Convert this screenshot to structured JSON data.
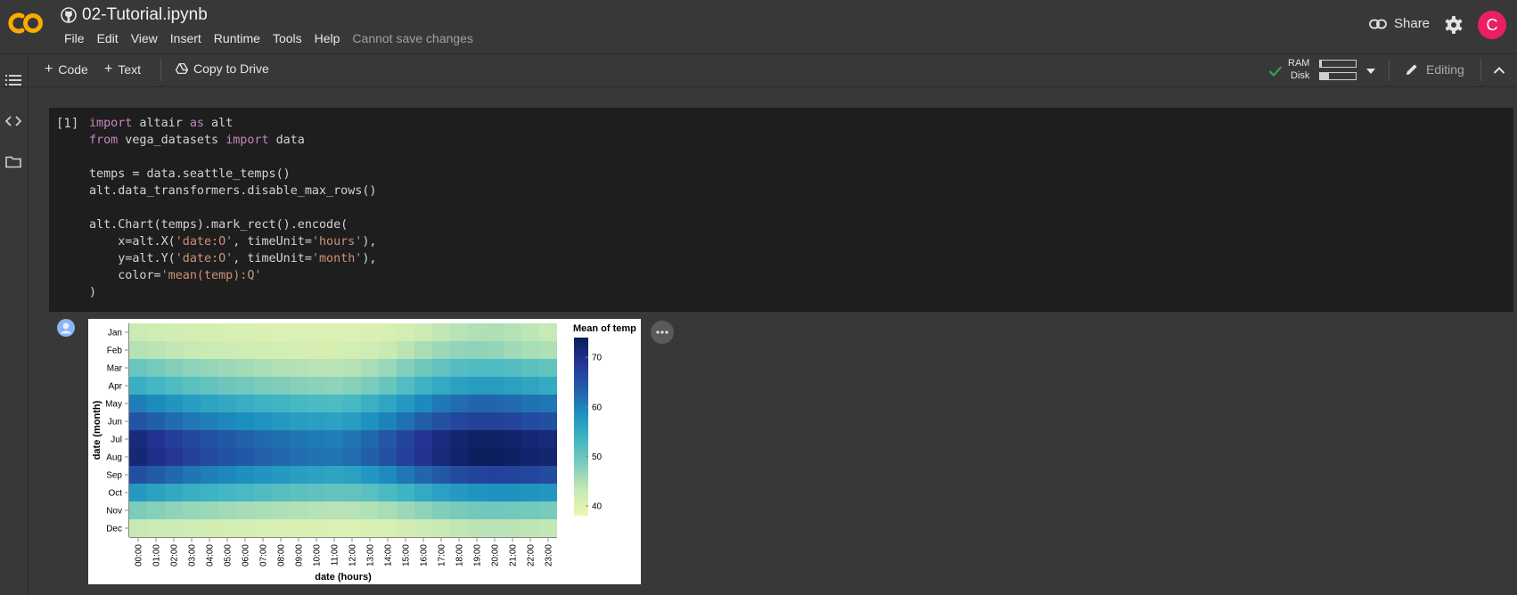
{
  "app": {
    "title": "02-Tutorial.ipynb",
    "menu": [
      "File",
      "Edit",
      "View",
      "Insert",
      "Runtime",
      "Tools",
      "Help"
    ],
    "save_note": "Cannot save changes",
    "share_label": "Share",
    "avatar_letter": "C",
    "logo_color": "#f9ab00"
  },
  "toolbar": {
    "code_label": "Code",
    "text_label": "Text",
    "copy_label": "Copy to Drive",
    "ram_label": "RAM",
    "disk_label": "Disk",
    "ram_fraction": 0.05,
    "disk_fraction": 0.25,
    "editing_label": "Editing"
  },
  "cell": {
    "execution_count": "[1]",
    "code_lines": [
      "import altair as alt",
      "from vega_datasets import data",
      "",
      "temps = data.seattle_temps()",
      "alt.data_transformers.disable_max_rows()",
      "",
      "alt.Chart(temps).mark_rect().encode(",
      "    x=alt.X('date:O', timeUnit='hours'),",
      "    y=alt.Y('date:O', timeUnit='month'),",
      "    color='mean(temp):Q'",
      ")"
    ]
  },
  "chart_data": {
    "type": "heatmap",
    "x": [
      "00:00",
      "01:00",
      "02:00",
      "03:00",
      "04:00",
      "05:00",
      "06:00",
      "07:00",
      "08:00",
      "09:00",
      "10:00",
      "11:00",
      "12:00",
      "13:00",
      "14:00",
      "15:00",
      "16:00",
      "17:00",
      "18:00",
      "19:00",
      "20:00",
      "21:00",
      "22:00",
      "23:00"
    ],
    "y": [
      "Jan",
      "Feb",
      "Mar",
      "Apr",
      "May",
      "Jun",
      "Jul",
      "Aug",
      "Sep",
      "Oct",
      "Nov",
      "Dec"
    ],
    "xlabel": "date (hours)",
    "ylabel": "date (month)",
    "legend_title": "Mean of temp",
    "legend_ticks": [
      70,
      60,
      50,
      40
    ],
    "color_domain": [
      38,
      74
    ],
    "color_scheme": [
      "#edf8b1",
      "#c7e9b4",
      "#7fcdbb",
      "#41b6c4",
      "#1d91c0",
      "#225ea8",
      "#253494",
      "#081d58"
    ],
    "values": [
      [
        42.5,
        42.2,
        41.8,
        41.5,
        41.2,
        41.0,
        40.8,
        40.6,
        40.5,
        40.4,
        40.3,
        40.3,
        40.4,
        40.6,
        41.0,
        41.6,
        42.5,
        43.5,
        44.3,
        44.8,
        44.9,
        44.5,
        43.8,
        43.1
      ],
      [
        44.5,
        44.0,
        43.5,
        43.0,
        42.6,
        42.3,
        42.0,
        41.7,
        41.5,
        41.3,
        41.2,
        41.2,
        41.5,
        42.0,
        42.8,
        44.0,
        45.3,
        46.3,
        47.0,
        47.2,
        46.8,
        46.0,
        45.4,
        44.9
      ],
      [
        50.0,
        49.0,
        48.0,
        47.3,
        46.7,
        46.2,
        45.7,
        45.2,
        44.8,
        44.5,
        44.2,
        44.1,
        44.5,
        45.3,
        46.5,
        48.0,
        49.5,
        50.8,
        51.8,
        52.3,
        52.3,
        51.8,
        51.2,
        50.6
      ],
      [
        54.5,
        53.3,
        52.2,
        51.3,
        50.6,
        49.9,
        49.3,
        48.7,
        48.2,
        47.8,
        47.4,
        47.2,
        47.8,
        48.8,
        50.3,
        52.0,
        53.8,
        55.3,
        56.4,
        57.0,
        57.0,
        56.5,
        55.8,
        55.1
      ],
      [
        60.5,
        59.2,
        58.0,
        57.0,
        56.1,
        55.4,
        54.7,
        54.0,
        53.5,
        53.0,
        52.6,
        52.4,
        53.0,
        54.2,
        55.8,
        57.6,
        59.4,
        61.0,
        62.2,
        62.9,
        62.9,
        62.4,
        61.7,
        61.1
      ],
      [
        65.0,
        63.6,
        62.3,
        61.2,
        60.3,
        59.5,
        58.8,
        58.1,
        57.5,
        57.0,
        56.6,
        56.4,
        57.0,
        58.3,
        60.0,
        61.8,
        63.7,
        65.3,
        66.6,
        67.3,
        67.3,
        66.8,
        66.1,
        65.5
      ],
      [
        70.8,
        69.2,
        67.7,
        66.4,
        65.3,
        64.3,
        63.4,
        62.6,
        61.9,
        61.3,
        60.8,
        60.6,
        61.3,
        62.8,
        64.7,
        66.8,
        68.8,
        70.6,
        72.0,
        72.8,
        72.9,
        72.4,
        71.7,
        71.2
      ],
      [
        71.5,
        70.0,
        68.6,
        67.3,
        66.2,
        65.2,
        64.3,
        63.5,
        62.8,
        62.2,
        61.7,
        61.5,
        62.2,
        63.6,
        65.4,
        67.4,
        69.3,
        71.0,
        72.4,
        73.3,
        73.5,
        73.1,
        72.4,
        71.9
      ],
      [
        65.5,
        64.0,
        62.6,
        61.4,
        60.4,
        59.5,
        58.7,
        58.0,
        57.4,
        56.8,
        56.3,
        56.0,
        56.5,
        57.7,
        59.3,
        61.1,
        62.9,
        64.5,
        65.9,
        66.8,
        67.1,
        66.9,
        66.5,
        66.0
      ],
      [
        57.5,
        56.4,
        55.4,
        54.6,
        53.9,
        53.3,
        52.7,
        52.2,
        51.7,
        51.3,
        50.9,
        50.6,
        50.8,
        51.4,
        52.5,
        53.8,
        55.2,
        56.5,
        57.5,
        58.2,
        58.4,
        58.3,
        58.0,
        57.7
      ],
      [
        48.5,
        47.8,
        47.2,
        46.7,
        46.3,
        45.9,
        45.5,
        45.2,
        44.9,
        44.6,
        44.4,
        44.2,
        44.3,
        44.7,
        45.4,
        46.3,
        47.3,
        48.2,
        48.9,
        49.3,
        49.5,
        49.4,
        49.2,
        48.9
      ],
      [
        43.0,
        42.6,
        42.3,
        42.0,
        41.7,
        41.5,
        41.3,
        41.1,
        40.9,
        40.7,
        40.6,
        40.5,
        40.5,
        40.7,
        41.1,
        41.7,
        42.4,
        43.1,
        43.6,
        44.0,
        44.1,
        44.0,
        43.8,
        43.5
      ]
    ]
  }
}
